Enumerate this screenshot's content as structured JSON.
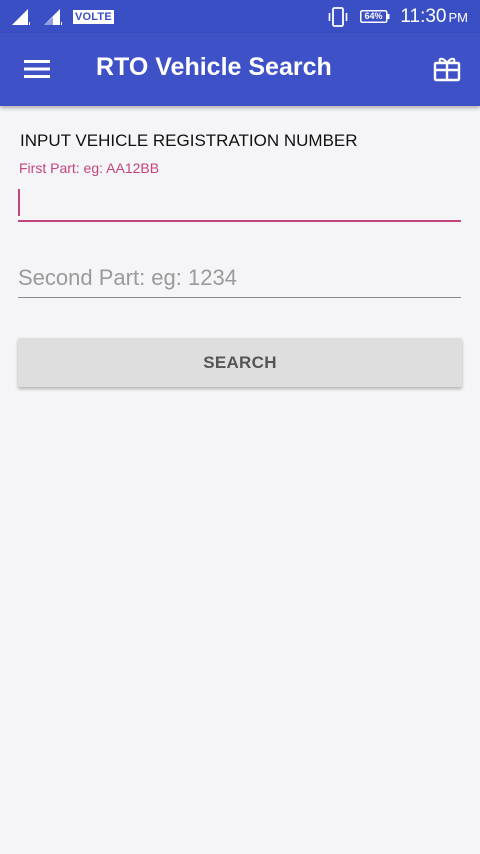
{
  "status_bar": {
    "network_badge": "VOLTE",
    "battery_level": "64%",
    "time": "11:30",
    "ampm": "PM",
    "icons": [
      "signal-icon",
      "signal-icon",
      "vibrate-icon",
      "battery-icon"
    ]
  },
  "app_bar": {
    "title": "RTO Vehicle Search",
    "menu_icon": "hamburger-menu-icon",
    "action_icon": "gift-icon",
    "color": "#3f51c7"
  },
  "form": {
    "heading": "INPUT VEHICLE REGISTRATION NUMBER",
    "first_part": {
      "label": "First Part: eg: AA12BB",
      "value": "",
      "accent_color": "#c2457e"
    },
    "second_part": {
      "placeholder": "Second Part: eg: 1234",
      "value": ""
    },
    "search_label": "SEARCH"
  }
}
